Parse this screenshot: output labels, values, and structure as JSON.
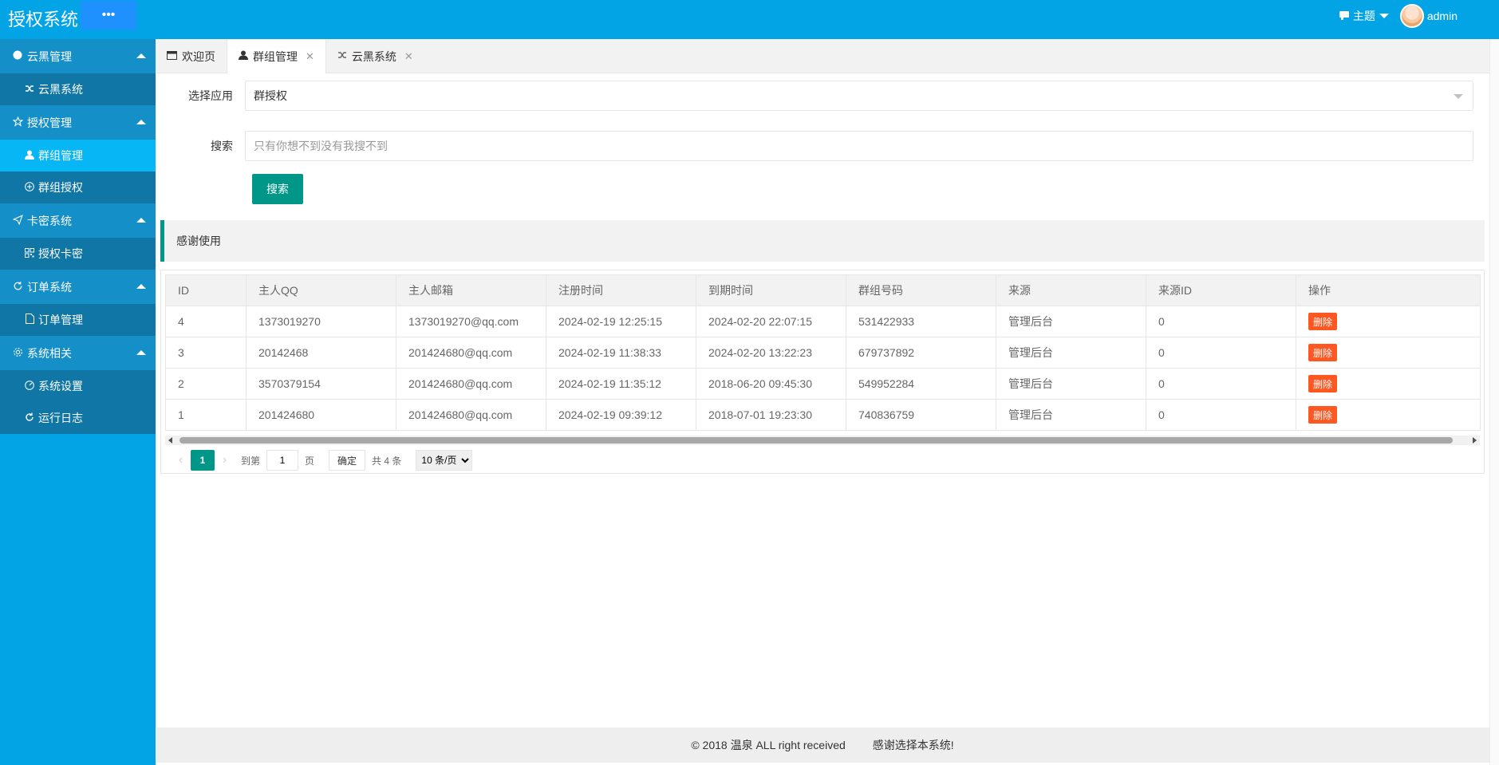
{
  "header": {
    "logo": "授权系统",
    "menu_toggle": "•••",
    "theme_label": "主题",
    "user_name": "admin"
  },
  "sidebar": {
    "groups": [
      {
        "label": "云黑管理",
        "icon": "circle-icon",
        "items": [
          {
            "label": "云黑系统",
            "icon": "shuffle-icon"
          }
        ]
      },
      {
        "label": "授权管理",
        "icon": "star-icon",
        "items": [
          {
            "label": "群组管理",
            "icon": "user-icon",
            "active": true
          },
          {
            "label": "群组授权",
            "icon": "plus-circle-icon"
          }
        ]
      },
      {
        "label": "卡密系统",
        "icon": "send-icon",
        "items": [
          {
            "label": "授权卡密",
            "icon": "qrcode-icon"
          }
        ]
      },
      {
        "label": "订单系统",
        "icon": "refresh-icon",
        "items": [
          {
            "label": "订单管理",
            "icon": "file-icon"
          }
        ]
      },
      {
        "label": "系统相关",
        "icon": "gear-icon",
        "items": [
          {
            "label": "系统设置",
            "icon": "dashboard-icon"
          },
          {
            "label": "运行日志",
            "icon": "loop-icon"
          }
        ]
      }
    ]
  },
  "tabs": [
    {
      "label": "欢迎页",
      "icon": "window-icon"
    },
    {
      "label": "群组管理",
      "icon": "user-icon",
      "active": true,
      "closable": true
    },
    {
      "label": "云黑系统",
      "icon": "shuffle-icon",
      "closable": true
    }
  ],
  "form": {
    "app_label": "选择应用",
    "app_value": "群授权",
    "search_label": "搜索",
    "search_placeholder": "只有你想不到没有我搜不到",
    "search_button": "搜索"
  },
  "notice": "感谢使用",
  "table": {
    "columns": [
      "ID",
      "主人QQ",
      "主人邮箱",
      "注册时间",
      "到期时间",
      "群组号码",
      "来源",
      "来源ID",
      "操作"
    ],
    "rows": [
      [
        "4",
        "1373019270",
        "1373019270@qq.com",
        "2024-02-19 12:25:15",
        "2024-02-20 22:07:15",
        "531422933",
        "管理后台",
        "0"
      ],
      [
        "3",
        "20142468",
        "201424680@qq.com",
        "2024-02-19 11:38:33",
        "2024-02-20 13:22:23",
        "679737892",
        "管理后台",
        "0"
      ],
      [
        "2",
        "3570379154",
        "201424680@qq.com",
        "2024-02-19 11:35:12",
        "2018-06-20 09:45:30",
        "549952284",
        "管理后台",
        "0"
      ],
      [
        "1",
        "201424680",
        "201424680@qq.com",
        "2024-02-19 09:39:12",
        "2018-07-01 19:23:30",
        "740836759",
        "管理后台",
        "0"
      ]
    ],
    "delete_label": "删除"
  },
  "pager": {
    "current": "1",
    "goto_label": "到第",
    "page_input": "1",
    "page_unit": "页",
    "confirm": "确定",
    "total": "共 4 条",
    "per_page": "10 条/页"
  },
  "footer": {
    "copyright": "© 2018 温泉 ALL right received",
    "thanks": "感谢选择本系统!"
  },
  "colors": {
    "primary_blue": "#03a4e6",
    "teal": "#009688",
    "danger": "#ff5722"
  }
}
